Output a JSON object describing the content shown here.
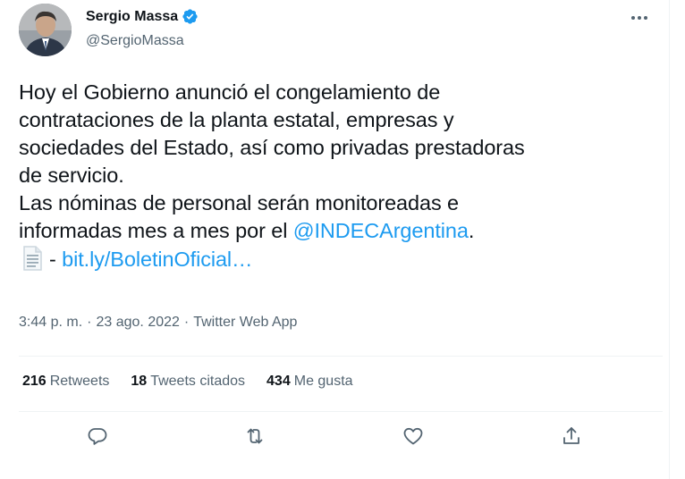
{
  "author": {
    "display_name": "Sergio Massa",
    "handle": "@SergioMassa"
  },
  "tweet": {
    "lines": {
      "l1": "Hoy el Gobierno anunció el congelamiento de",
      "l2": "contrataciones de la planta estatal, empresas y",
      "l3": "sociedades del Estado, así como privadas prestadoras",
      "l4": "de servicio.",
      "l5": "Las nóminas de personal serán monitoreadas e",
      "l6_prefix": "informadas mes a mes por el ",
      "l6_mention": "@INDECArgentina",
      "l6_suffix": ".",
      "l7_prefix": "- ",
      "l7_link": "bit.ly/BoletinOficial…"
    }
  },
  "meta": {
    "time": "3:44 p. m.",
    "separator": "·",
    "date": "23 ago. 2022",
    "source": "Twitter Web App"
  },
  "stats": {
    "retweets_count": "216",
    "retweets_label": "Retweets",
    "quotes_count": "18",
    "quotes_label": "Tweets citados",
    "likes_count": "434",
    "likes_label": "Me gusta"
  },
  "colors": {
    "link": "#1d9bf0",
    "secondary_text": "#536471",
    "primary_text": "#0f1419",
    "divider": "#eff3f4"
  },
  "icons": [
    "verified-badge-icon",
    "more-icon",
    "document-icon",
    "reply-icon",
    "retweet-icon",
    "like-icon",
    "share-icon"
  ]
}
